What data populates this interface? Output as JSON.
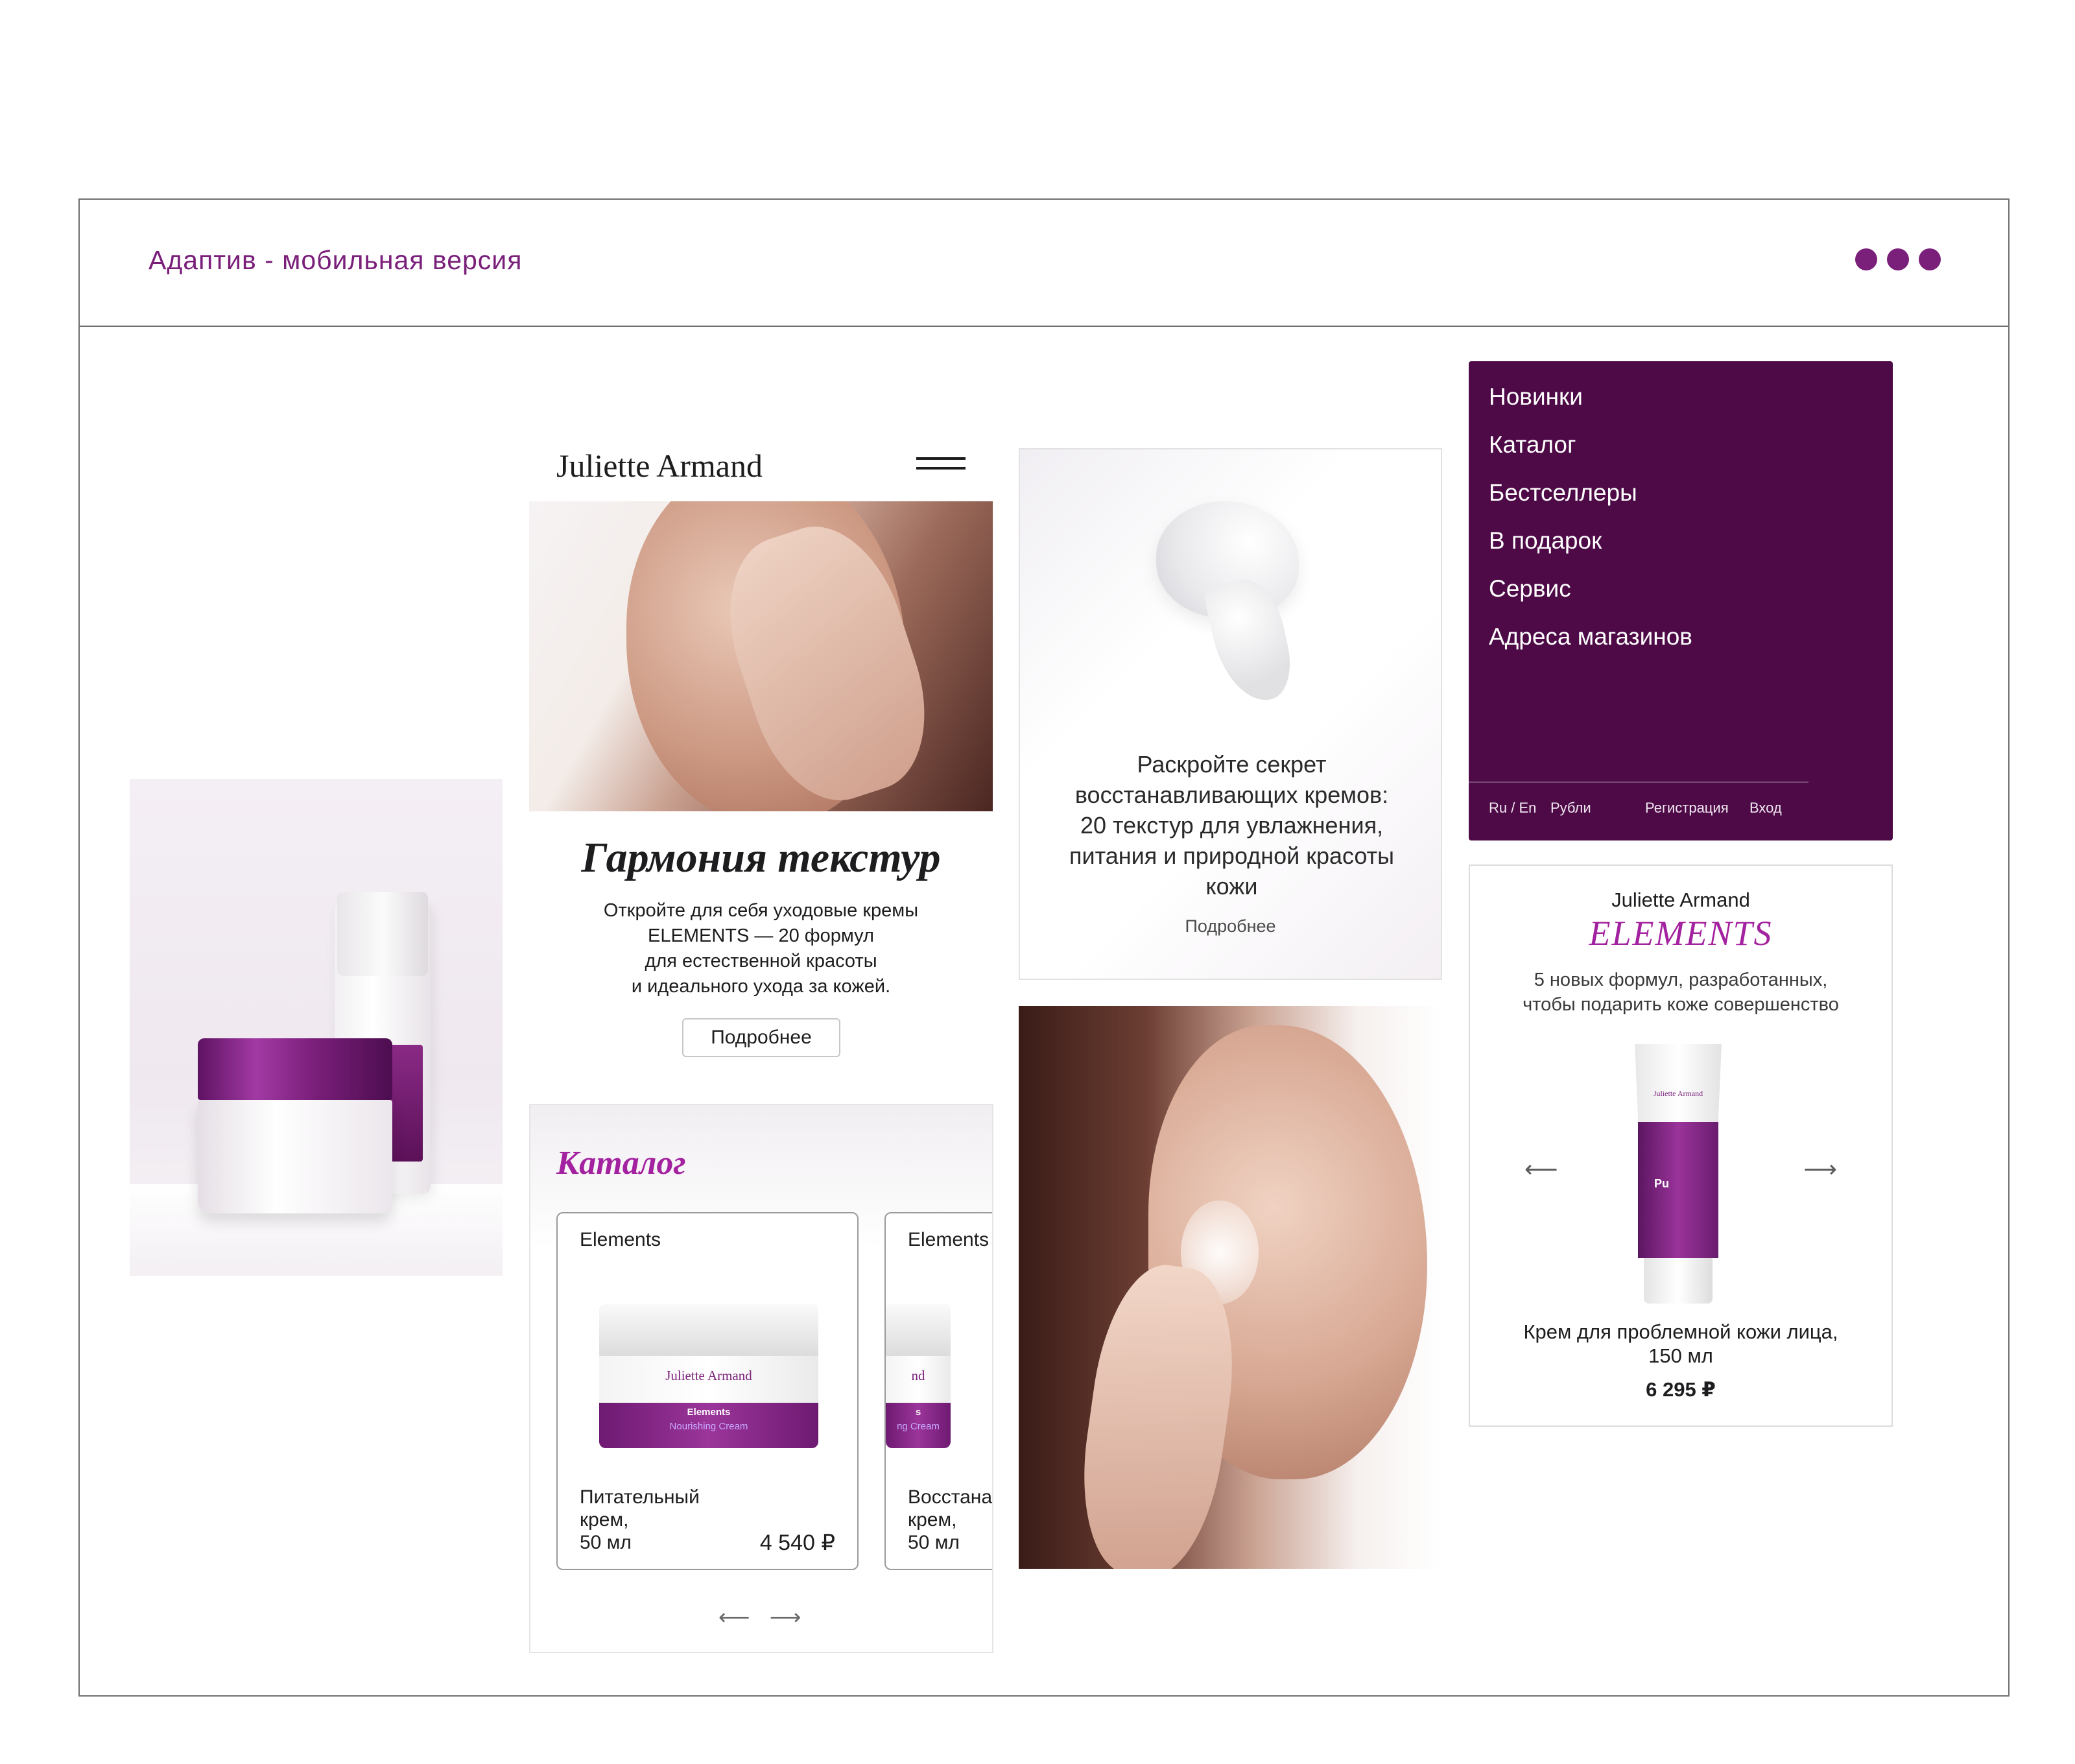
{
  "frame": {
    "title": "Адаптив - мобильная версия",
    "dots_color": "#7a1f7a"
  },
  "hero": {
    "brand": "Juliette Armand",
    "title": "Гармония текстур",
    "text_lines": [
      "Откройте для себя уходовые кремы",
      "ELEMENTS — 20 формул",
      "для естественной красоты",
      "и идеального ухода за кожей."
    ],
    "button": "Подробнее"
  },
  "catalog": {
    "title": "Каталог",
    "cards": [
      {
        "label": "Elements",
        "jar_brand": "Juliette Armand",
        "jar_line1": "Elements",
        "jar_line2": "Nourishing Cream",
        "name_lines": [
          "Питательный",
          "крем,",
          "50 мл"
        ],
        "price": "4 540 ₽"
      },
      {
        "label": "Elements",
        "jar_brand": "nd",
        "jar_line1": "s",
        "jar_line2": "ng Cream",
        "name_lines": [
          "Восстана",
          "крем,",
          "50 мл"
        ],
        "price": ""
      }
    ],
    "arrow_prev": "⟵",
    "arrow_next": "⟶"
  },
  "cream_card": {
    "text_lines": [
      "Раскройте секрет",
      "восстанавливающих кремов:",
      "20 текстур для увлажнения,",
      "питания и природной красоты",
      "кожи"
    ],
    "link": "Подробнее"
  },
  "menu": {
    "items": [
      "Новинки",
      "Каталог",
      "Бестселлеры",
      "В подарок",
      "Сервис",
      "Адреса магазинов"
    ],
    "lang": "Ru / En",
    "currency": "Рубли",
    "register": "Регистрация",
    "login": "Вход",
    "bg_color": "#4d0a47"
  },
  "elements_card": {
    "brand": "Juliette Armand",
    "title": "ELEMENTS",
    "subtitle_lines": [
      "5 новых формул, разработанных,",
      "чтобы подарить коже совершенство"
    ],
    "tube_brand": "Juliette Armand",
    "tube_mark": "Pu",
    "arrow_prev": "⟵",
    "arrow_next": "⟶",
    "name_lines": [
      "Крем для проблемной кожи лица,",
      "150 мл"
    ],
    "price": "6 295 ₽",
    "accent_color": "#a3229f"
  }
}
